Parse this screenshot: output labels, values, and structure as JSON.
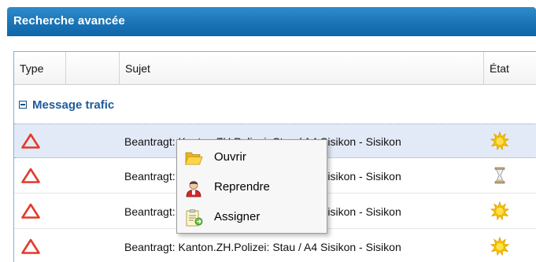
{
  "panel": {
    "title": "Recherche avancée"
  },
  "grid": {
    "columns": {
      "type": "Type",
      "extra": "",
      "subject": "Sujet",
      "state": "État"
    },
    "group": {
      "label": "Message trafic",
      "expanded": true
    },
    "rows": [
      {
        "type_icon": "warning-triangle-icon",
        "subject": "Beantragt: Kanton.ZH.Polizei: Stau / A4 Sisikon - Sisikon",
        "state_icon": "sun-icon",
        "selected": true
      },
      {
        "type_icon": "warning-triangle-icon",
        "subject": "Beantragt: Kanton.ZH.Polizei: Stau / A4 Sisikon - Sisikon",
        "state_icon": "hourglass-icon",
        "selected": false
      },
      {
        "type_icon": "warning-triangle-icon",
        "subject": "Beantragt: Kanton.ZH.Polizei: Stau / A4 Sisikon - Sisikon",
        "state_icon": "sun-icon",
        "selected": false
      },
      {
        "type_icon": "warning-triangle-icon",
        "subject": "Beantragt: Kanton.ZH.Polizei: Stau / A4 Sisikon - Sisikon",
        "state_icon": "sun-icon",
        "selected": false
      }
    ]
  },
  "context_menu": {
    "items": [
      {
        "label": "Ouvrir",
        "icon": "folder-open-icon"
      },
      {
        "label": "Reprendre",
        "icon": "user-icon"
      },
      {
        "label": "Assigner",
        "icon": "assign-note-icon"
      }
    ]
  },
  "colors": {
    "header_blue": "#1a74b6",
    "group_label": "#1e5a9c",
    "selected_row": "#e3eaf7",
    "warning_red": "#e23a2c",
    "sun_yellow": "#f6c300"
  }
}
